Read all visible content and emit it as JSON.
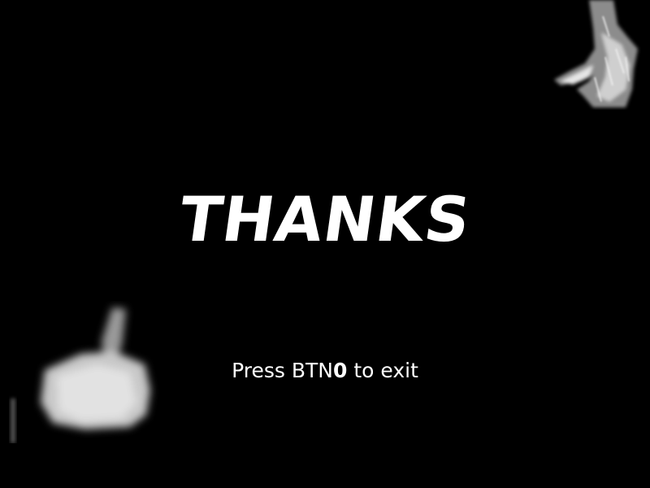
{
  "screen": {
    "background": "#000000",
    "text_color": "#ffffff",
    "title": "THANKS",
    "prompt_before": "Press BTN",
    "prompt_key": "0",
    "prompt_after": " to exit"
  },
  "images": {
    "top_right": "open-hand-image",
    "bottom_left": "thumbs-up-hand-image"
  }
}
